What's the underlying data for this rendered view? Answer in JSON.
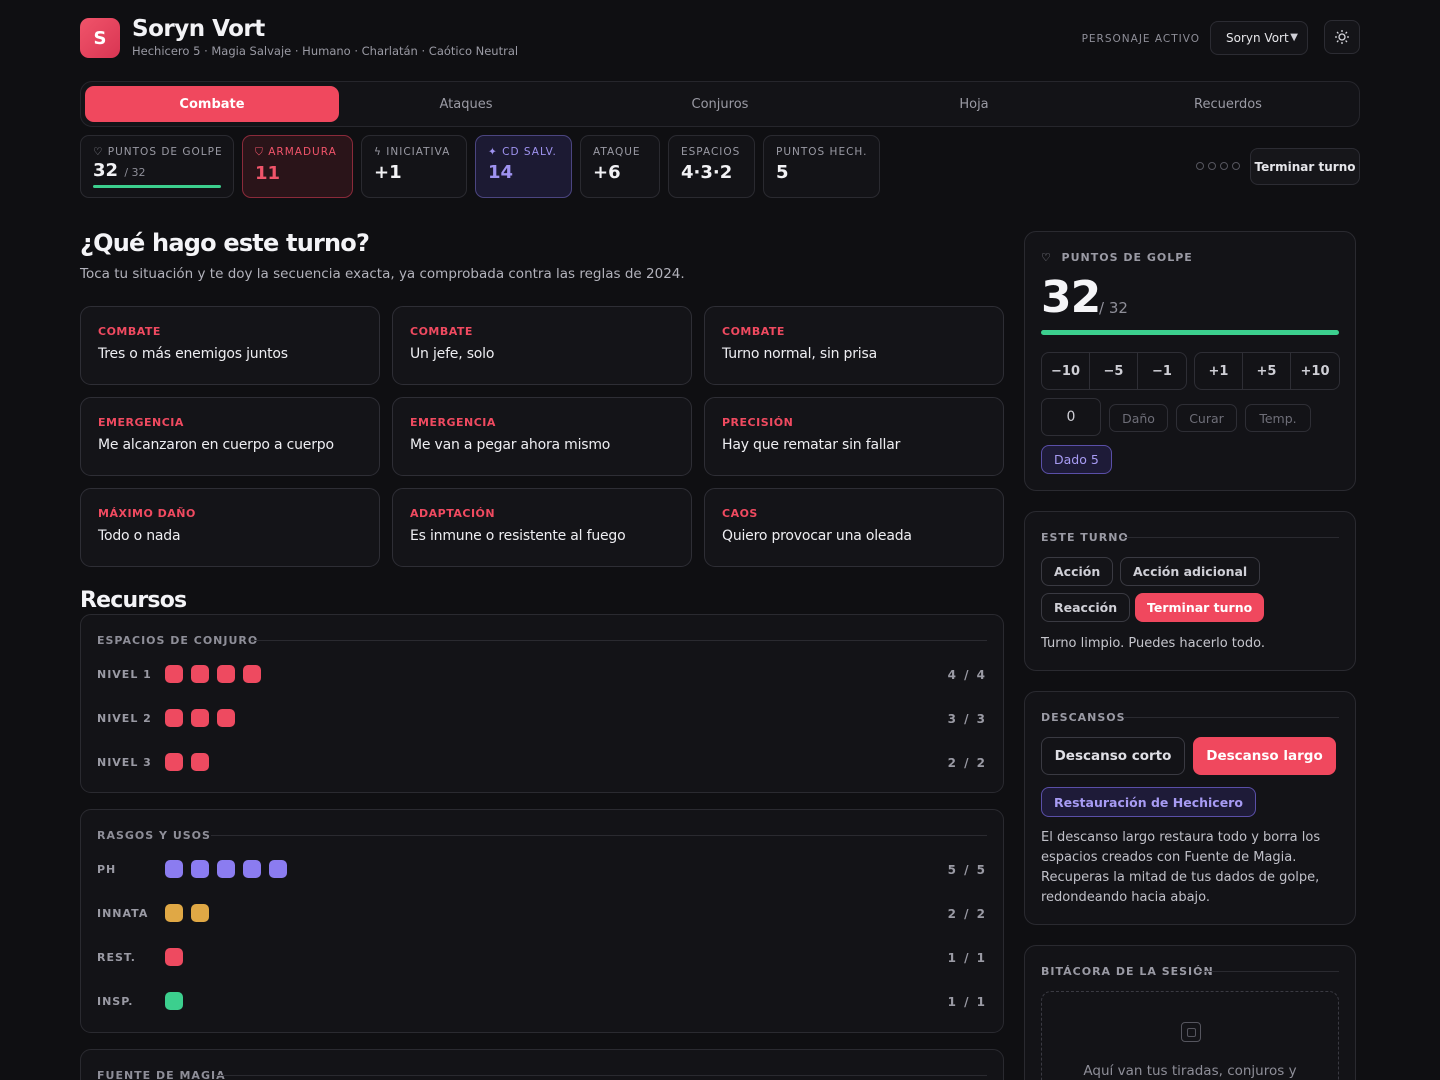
{
  "header": {
    "logo_letter": "S",
    "name": "Soryn Vort",
    "subtitle": "Hechicero 5 · Magia Salvaje · Humano · Charlatán · Caótico Neutral",
    "active_label": "PERSONAJE ACTIVO",
    "active_character": "Soryn Vort"
  },
  "tabs": [
    "Combate",
    "Ataques",
    "Conjuros",
    "Hoja",
    "Recuerdos"
  ],
  "stats": {
    "hp": {
      "label": "PUNTOS DE GOLPE",
      "value": "32",
      "max": "/ 32"
    },
    "armor": {
      "label": "ARMADURA",
      "value": "11"
    },
    "initiative": {
      "label": "INICIATIVA",
      "value": "+1"
    },
    "save_dc": {
      "label": "CD SALV.",
      "value": "14"
    },
    "attack": {
      "label": "ATAQUE",
      "value": "+6"
    },
    "slots": {
      "label": "ESPACIOS",
      "value": "4·3·2"
    },
    "sorcery": {
      "label": "PUNTOS HECH.",
      "value": "5"
    }
  },
  "end_turn_top": "Terminar turno",
  "turn": {
    "title": "¿Qué hago este turno?",
    "lead": "Toca tu situación y te doy la secuencia exacta, ya comprobada contra las reglas de 2024.",
    "situations": [
      {
        "cat": "COMBATE",
        "text": "Tres o más enemigos juntos"
      },
      {
        "cat": "COMBATE",
        "text": "Un jefe, solo"
      },
      {
        "cat": "COMBATE",
        "text": "Turno normal, sin prisa"
      },
      {
        "cat": "EMERGENCIA",
        "text": "Me alcanzaron en cuerpo a cuerpo"
      },
      {
        "cat": "EMERGENCIA",
        "text": "Me van a pegar ahora mismo"
      },
      {
        "cat": "PRECISIÓN",
        "text": "Hay que rematar sin fallar"
      },
      {
        "cat": "MÁXIMO DAÑO",
        "text": "Todo o nada"
      },
      {
        "cat": "ADAPTACIÓN",
        "text": "Es inmune o resistente al fuego"
      },
      {
        "cat": "CAOS",
        "text": "Quiero provocar una oleada"
      }
    ]
  },
  "resources": {
    "title": "Recursos",
    "spell_slots": {
      "title": "ESPACIOS DE CONJURO",
      "rows": [
        {
          "label": "NIVEL 1",
          "count": "4 / 4",
          "filled": 4,
          "color": "#ee4a60"
        },
        {
          "label": "NIVEL 2",
          "count": "3 / 3",
          "filled": 3,
          "color": "#ee4a60"
        },
        {
          "label": "NIVEL 3",
          "count": "2 / 2",
          "filled": 2,
          "color": "#ee4a60"
        }
      ]
    },
    "traits": {
      "title": "RASGOS Y USOS",
      "rows": [
        {
          "label": "PH",
          "count": "5 / 5",
          "filled": 5,
          "color": "#8b7cf0"
        },
        {
          "label": "INNATA",
          "count": "2 / 2",
          "filled": 2,
          "color": "#e0a845"
        },
        {
          "label": "REST.",
          "count": "1 / 1",
          "filled": 1,
          "color": "#ee4a60"
        },
        {
          "label": "INSP.",
          "count": "1 / 1",
          "filled": 1,
          "color": "#3ccf8e"
        }
      ]
    },
    "magic_source": {
      "title": "FUENTE DE MAGIA"
    }
  },
  "hp_card": {
    "title": "PUNTOS DE GOLPE",
    "value": "32",
    "max": "/ 32",
    "fraction": 1.0,
    "minus": [
      "−10",
      "−5",
      "−1"
    ],
    "plus": [
      "+1",
      "+5",
      "+10"
    ],
    "amount": "0",
    "damage": "Daño",
    "heal": "Curar",
    "temp": "Temp.",
    "hit_die": "Dado 5"
  },
  "this_turn": {
    "title": "ESTE TURNO",
    "action": "Acción",
    "bonus": "Acción adicional",
    "reaction": "Reacción",
    "end": "Terminar turno",
    "note": "Turno limpio. Puedes hacerlo todo."
  },
  "rests": {
    "title": "DESCANSOS",
    "short": "Descanso corto",
    "long": "Descanso largo",
    "restoration": "Restauración de Hechicero",
    "note": "El descanso largo restaura todo y borra los espacios creados con Fuente de Magia. Recuperas la mitad de tus dados de golpe, redondeando hacia abajo."
  },
  "log": {
    "title": "BITÁCORA DE LA SESIÓN",
    "empty": "Aquí van tus tiradas, conjuros y"
  },
  "colors": {
    "accent": "#f0485e",
    "violet": "#8b7cf0",
    "green": "#3ccf8e",
    "gold": "#e0a845"
  }
}
